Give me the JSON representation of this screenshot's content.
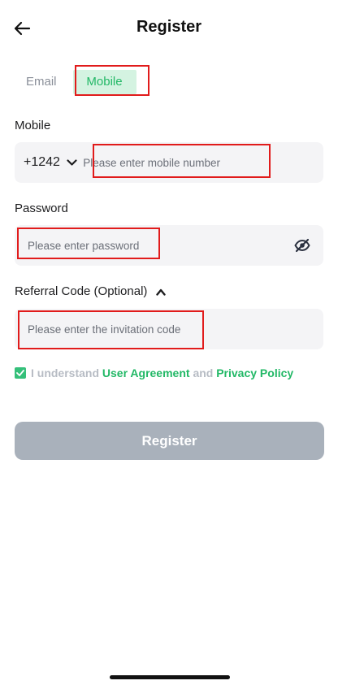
{
  "header": {
    "title": "Register",
    "back_icon": "arrow-left-icon"
  },
  "tabs": [
    {
      "label": "Email",
      "active": false
    },
    {
      "label": "Mobile",
      "active": true
    }
  ],
  "mobile": {
    "label": "Mobile",
    "country_code": "+1242",
    "placeholder": "Please enter mobile number",
    "value": ""
  },
  "password": {
    "label": "Password",
    "placeholder": "Please enter password",
    "value": "",
    "toggle_icon": "eye-off-icon"
  },
  "referral": {
    "label": "Referral Code (Optional)",
    "placeholder": "Please enter the invitation code",
    "value": "",
    "expanded": true
  },
  "agreement": {
    "checked": true,
    "prefix": "I understand",
    "user_agreement": "User Agreement",
    "conjunction": "and",
    "privacy_policy": "Privacy Policy"
  },
  "submit": {
    "label": "Register",
    "enabled": false
  },
  "colors": {
    "accent": "#22b866",
    "tab_active_bg": "#d4f3e1",
    "button_disabled": "#a9b1bb",
    "highlight": "#e11b1b"
  }
}
